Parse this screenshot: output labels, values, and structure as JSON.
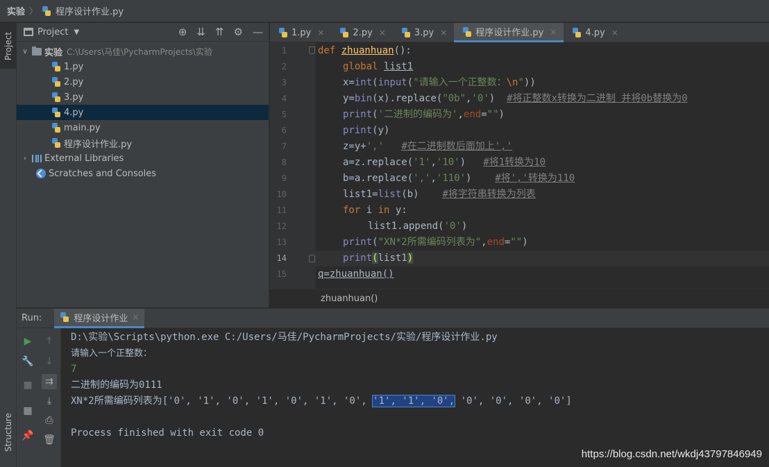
{
  "breadcrumb": {
    "root": "实验",
    "file": "程序设计作业.py"
  },
  "left_strip": {
    "project_tab": "Project",
    "structure_tab": "Structure"
  },
  "project_panel": {
    "title": "Project",
    "tree": [
      {
        "type": "folder",
        "label": "实验",
        "path": "C:\\Users\\马佳\\PycharmProjects\\实验",
        "expanded": true
      },
      {
        "type": "py",
        "label": "1.py"
      },
      {
        "type": "py",
        "label": "2.py"
      },
      {
        "type": "py",
        "label": "3.py"
      },
      {
        "type": "py",
        "label": "4.py",
        "selected": true
      },
      {
        "type": "py",
        "label": "main.py"
      },
      {
        "type": "py",
        "label": "程序设计作业.py"
      },
      {
        "type": "lib",
        "label": "External Libraries"
      },
      {
        "type": "scratch",
        "label": "Scratches and Consoles"
      }
    ]
  },
  "editor": {
    "tabs": [
      {
        "label": "1.py",
        "active": false
      },
      {
        "label": "2.py",
        "active": false
      },
      {
        "label": "3.py",
        "active": false
      },
      {
        "label": "程序设计作业.py",
        "active": true
      },
      {
        "label": "4.py",
        "active": false
      }
    ],
    "line_numbers": [
      "1",
      "2",
      "3",
      "4",
      "5",
      "6",
      "7",
      "8",
      "9",
      "10",
      "11",
      "12",
      "13",
      "14",
      "15"
    ],
    "current_line": 14,
    "code": {
      "l1_def": "def ",
      "l1_name": "zhuanhuan",
      "l1_rest": "():",
      "l2_kw": "global ",
      "l2_var": "list1",
      "l3_a": "x=",
      "l3_int": "int",
      "l3_b": "(",
      "l3_input": "input",
      "l3_c": "(",
      "l3_str": "\"请输入一个正整数：",
      "l3_esc": "\\n",
      "l3_str2": "\"",
      "l3_d": "))",
      "l4_a": "y=",
      "l4_bin": "bin",
      "l4_b": "(x).replace(",
      "l4_s1": "\"0b\"",
      "l4_c": ",",
      "l4_s2": "'0'",
      "l4_d": ")  ",
      "l4_cm": "#将正整数x转换为二进制 并将0b替换为0",
      "l5_print": "print",
      "l5_a": "(",
      "l5_s": "'二进制的编码为'",
      "l5_b": ",",
      "l5_end": "end",
      "l5_c": "=",
      "l5_s2": "\"\"",
      "l5_d": ")",
      "l6_print": "print",
      "l6_a": "(y)",
      "l7_a": "z=y+",
      "l7_s": "','",
      "l7_b": "   ",
      "l7_cm": "#在二进制数后面加上','",
      "l8_a": "a=z.replace(",
      "l8_s1": "'1'",
      "l8_b": ",",
      "l8_s2": "'10'",
      "l8_c": ")   ",
      "l8_cm": "#将1转换为10",
      "l9_a": "b=a.replace(",
      "l9_s1": "','",
      "l9_b": ",",
      "l9_s2": "'110'",
      "l9_c": ")    ",
      "l9_cm": "#将','转换为110",
      "l10_a": "list1=",
      "l10_list": "list",
      "l10_b": "(b)    ",
      "l10_cm": "#将字符串转换为列表",
      "l11_for": "for ",
      "l11_a": "i ",
      "l11_in": "in ",
      "l11_b": "y:",
      "l12_a": "list1.append(",
      "l12_s": "'0'",
      "l12_b": ")",
      "l13_print": "print",
      "l13_a": "(",
      "l13_s": "\"XN*2所需编码列表为\"",
      "l13_b": ",",
      "l13_end": "end",
      "l13_c": "=",
      "l13_s2": "\"\"",
      "l13_d": ")",
      "l14_print": "print",
      "l14_a": "(",
      "l14_b": "list1",
      "l14_c": ")",
      "l15_a": "q=zhuanhuan()"
    },
    "bottom_crumb": "zhuanhuan()"
  },
  "run_panel": {
    "label": "Run:",
    "tab": "程序设计作业",
    "console": [
      "D:\\实验\\Scripts\\python.exe C:/Users/马佳/PycharmProjects/实验/程序设计作业.py",
      "请输入一个正整数：",
      "7",
      "二进制的编码为0111",
      "XN*2所需编码列表为['0', '1', '0', '1', '0', '1', '0', ",
      "'1', '1', '0',",
      " '0', '0', '0', '0']",
      "Process finished with exit code 0"
    ]
  },
  "watermark": "https://blog.csdn.net/wkdj43797846949"
}
